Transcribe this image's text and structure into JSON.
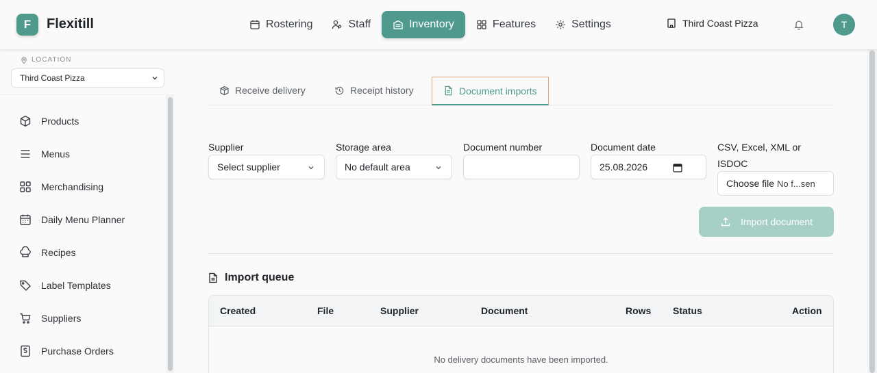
{
  "app": {
    "logo_letter": "F",
    "name": "Flexitill"
  },
  "nav": {
    "items": [
      {
        "label": "Rostering",
        "icon": "calendar-icon"
      },
      {
        "label": "Staff",
        "icon": "users-icon"
      },
      {
        "label": "Inventory",
        "icon": "inventory-icon",
        "active": true
      },
      {
        "label": "Features",
        "icon": "grid-icon"
      },
      {
        "label": "Settings",
        "icon": "gear-icon"
      }
    ],
    "venue": "Third Coast Pizza",
    "avatar_letter": "T"
  },
  "sidebar": {
    "location_label": "LOCATION",
    "location_value": "Third Coast Pizza",
    "items": [
      {
        "label": "Products",
        "icon": "box-icon"
      },
      {
        "label": "Menus",
        "icon": "menu-lines-icon"
      },
      {
        "label": "Merchandising",
        "icon": "grid-icon"
      },
      {
        "label": "Daily Menu Planner",
        "icon": "calendar-icon"
      },
      {
        "label": "Recipes",
        "icon": "chef-hat-icon"
      },
      {
        "label": "Label Templates",
        "icon": "tag-icon"
      },
      {
        "label": "Suppliers",
        "icon": "cart-icon"
      },
      {
        "label": "Purchase Orders",
        "icon": "dollar-document-icon"
      }
    ]
  },
  "tabs": [
    {
      "label": "Receive delivery",
      "icon": "package-icon"
    },
    {
      "label": "Receipt history",
      "icon": "history-icon"
    },
    {
      "label": "Document imports",
      "icon": "document-icon",
      "active": true
    }
  ],
  "form": {
    "supplier_label": "Supplier",
    "supplier_value": "Select supplier",
    "storage_label": "Storage area",
    "storage_value": "No default area",
    "docnum_label": "Document number",
    "docnum_value": "",
    "docdate_label": "Document date",
    "docdate_value": "25.08.2026",
    "file_label_line1": "CSV, Excel, XML or",
    "file_label_line2": "ISDOC",
    "file_button": "Choose file",
    "file_status": "No f...sen",
    "import_button": "Import document"
  },
  "queue": {
    "title": "Import queue",
    "columns": [
      "Created",
      "File",
      "Supplier",
      "Document",
      "Rows",
      "Status",
      "Action"
    ],
    "empty_text": "No delivery documents have been imported."
  },
  "colors": {
    "accent": "#4f9a8d",
    "accent_disabled": "#a6cfc7",
    "focus_outline": "#e4a27f"
  }
}
